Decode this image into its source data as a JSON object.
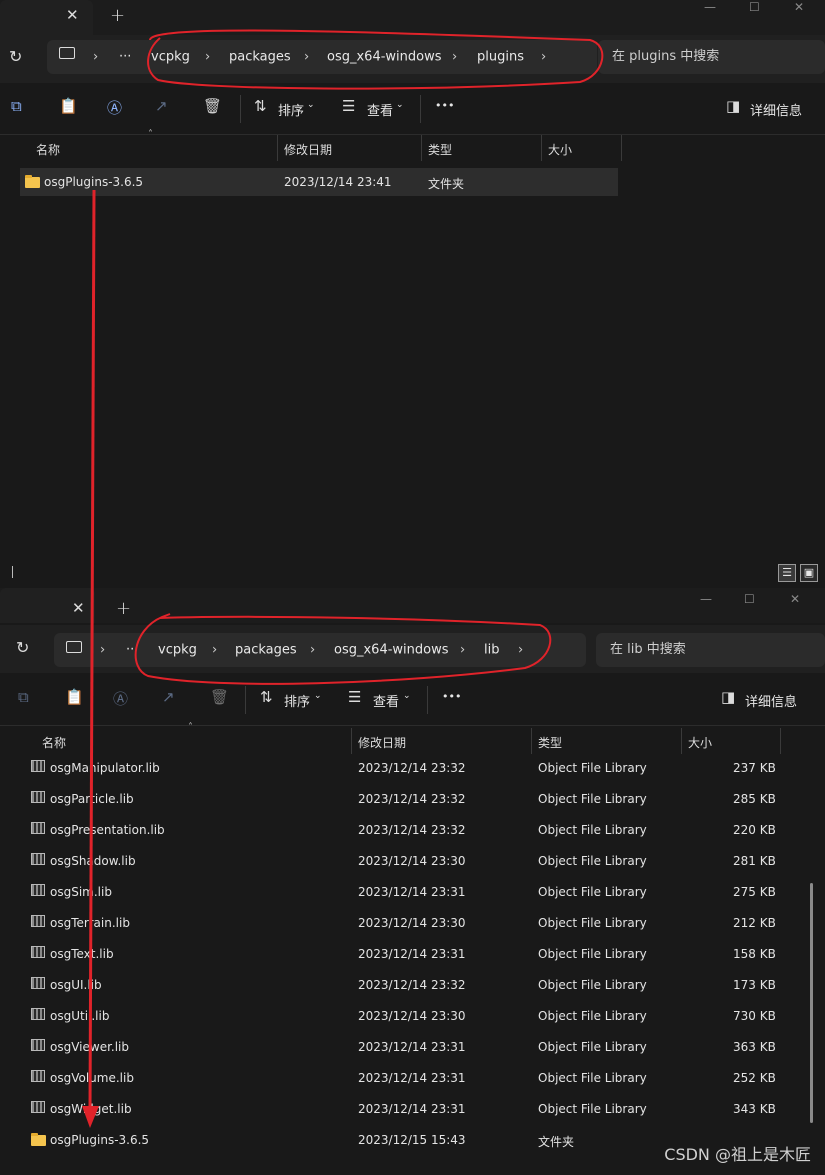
{
  "window1": {
    "breadcrumbs": [
      "vcpkg",
      "packages",
      "osg_x64-windows",
      "plugins"
    ],
    "search_placeholder": "在 plugins 中搜索",
    "toolbar": {
      "sort": "排序",
      "view": "查看",
      "more": "•••",
      "details": "详细信息"
    },
    "columns": {
      "name": "名称",
      "date": "修改日期",
      "type": "类型",
      "size": "大小"
    },
    "rows": [
      {
        "name": "osgPlugins-3.6.5",
        "date": "2023/12/14 23:41",
        "type": "文件夹",
        "size": ""
      }
    ]
  },
  "window2": {
    "breadcrumbs": [
      "vcpkg",
      "packages",
      "osg_x64-windows",
      "lib"
    ],
    "search_placeholder": "在 lib 中搜索",
    "toolbar": {
      "sort": "排序",
      "view": "查看",
      "more": "•••",
      "details": "详细信息"
    },
    "columns": {
      "name": "名称",
      "date": "修改日期",
      "type": "类型",
      "size": "大小"
    },
    "rows": [
      {
        "name": "osgManipulator.lib",
        "date": "2023/12/14 23:32",
        "type": "Object File Library",
        "size": "237 KB"
      },
      {
        "name": "osgParticle.lib",
        "date": "2023/12/14 23:32",
        "type": "Object File Library",
        "size": "285 KB"
      },
      {
        "name": "osgPresentation.lib",
        "date": "2023/12/14 23:32",
        "type": "Object File Library",
        "size": "220 KB"
      },
      {
        "name": "osgShadow.lib",
        "date": "2023/12/14 23:30",
        "type": "Object File Library",
        "size": "281 KB"
      },
      {
        "name": "osgSim.lib",
        "date": "2023/12/14 23:31",
        "type": "Object File Library",
        "size": "275 KB"
      },
      {
        "name": "osgTerrain.lib",
        "date": "2023/12/14 23:30",
        "type": "Object File Library",
        "size": "212 KB"
      },
      {
        "name": "osgText.lib",
        "date": "2023/12/14 23:31",
        "type": "Object File Library",
        "size": "158 KB"
      },
      {
        "name": "osgUI.lib",
        "date": "2023/12/14 23:32",
        "type": "Object File Library",
        "size": "173 KB"
      },
      {
        "name": "osgUtil.lib",
        "date": "2023/12/14 23:30",
        "type": "Object File Library",
        "size": "730 KB"
      },
      {
        "name": "osgViewer.lib",
        "date": "2023/12/14 23:31",
        "type": "Object File Library",
        "size": "363 KB"
      },
      {
        "name": "osgVolume.lib",
        "date": "2023/12/14 23:31",
        "type": "Object File Library",
        "size": "252 KB"
      },
      {
        "name": "osgWidget.lib",
        "date": "2023/12/14 23:31",
        "type": "Object File Library",
        "size": "343 KB"
      },
      {
        "name": "osgPlugins-3.6.5",
        "date": "2023/12/15 15:43",
        "type": "文件夹",
        "size": ""
      }
    ]
  },
  "watermark": "CSDN @祖上是木匠",
  "colors": {
    "annotation": "#e0232a",
    "folder": "#f4c44e",
    "accent": "#8fb6ff"
  }
}
